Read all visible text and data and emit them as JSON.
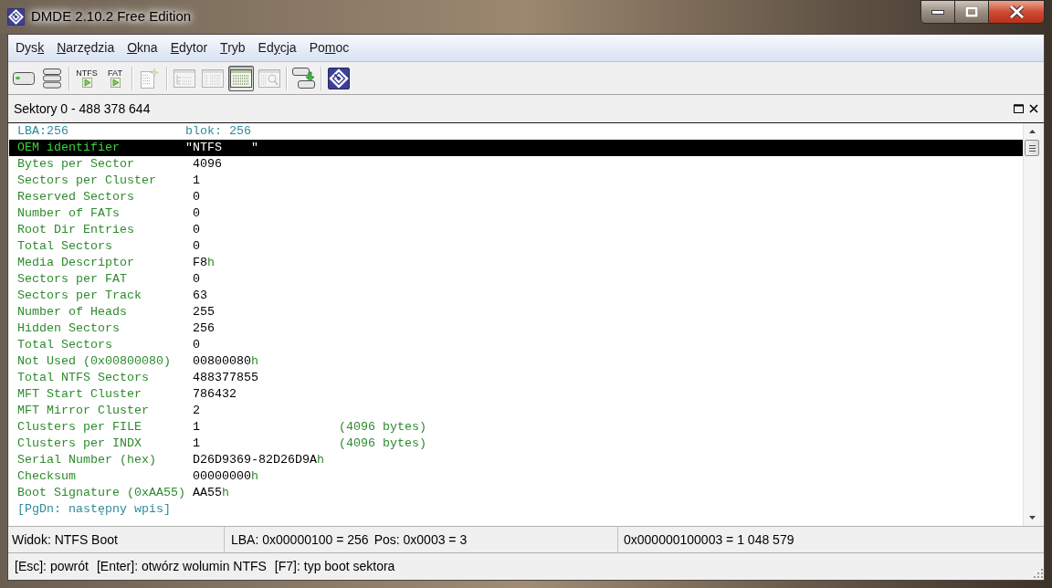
{
  "window": {
    "title": "DMDE 2.10.2 Free Edition"
  },
  "menu": [
    {
      "pre": "Dys",
      "accel": "k"
    },
    {
      "accel": "N",
      "post": "arzędzia"
    },
    {
      "accel": "O",
      "post": "kna"
    },
    {
      "accel": "E",
      "post": "dytor"
    },
    {
      "accel": "T",
      "post": "ryb"
    },
    {
      "pre": "Ed",
      "accel": "y",
      "post": "cja"
    },
    {
      "pre": "Po",
      "accel": "m",
      "post": "oc"
    }
  ],
  "toolbar": {
    "groups": [
      [
        {
          "kind": "drive",
          "disabled": false,
          "pressed": false
        },
        {
          "kind": "drive-stack",
          "disabled": false,
          "pressed": false
        }
      ],
      [
        {
          "kind": "labeled",
          "label": "NTFS",
          "disabled": false,
          "pressed": false
        },
        {
          "kind": "labeled",
          "label": "FAT",
          "disabled": false,
          "pressed": false
        }
      ],
      [
        {
          "kind": "new-doc",
          "disabled": true,
          "pressed": false
        }
      ],
      [
        {
          "kind": "tree-view",
          "disabled": true,
          "pressed": false
        },
        {
          "kind": "list-view",
          "disabled": true,
          "pressed": false
        },
        {
          "kind": "table-view",
          "disabled": false,
          "pressed": true
        },
        {
          "kind": "search-view",
          "disabled": true,
          "pressed": false
        }
      ],
      [
        {
          "kind": "copy",
          "disabled": false,
          "pressed": false
        }
      ],
      [
        {
          "kind": "logo",
          "disabled": false,
          "pressed": false
        }
      ]
    ]
  },
  "panel": {
    "title": "Sektory 0 - 488 378 644"
  },
  "header": {
    "lba": "LBA:256",
    "block": "blok: 256"
  },
  "rows": [
    {
      "label": "OEM identifier",
      "value": "\"NTFS    \"",
      "kind": "quoted",
      "selected": true
    },
    {
      "label": "Bytes per Sector",
      "value": "4096",
      "kind": "plain",
      "selected": false
    },
    {
      "label": "Sectors per Cluster",
      "value": "1",
      "kind": "plain",
      "selected": false
    },
    {
      "label": "Reserved Sectors",
      "value": "0",
      "kind": "plain",
      "selected": false
    },
    {
      "label": "Number of FATs",
      "value": "0",
      "kind": "plain",
      "selected": false
    },
    {
      "label": "Root Dir Entries",
      "value": "0",
      "kind": "plain",
      "selected": false
    },
    {
      "label": "Total Sectors",
      "value": "0",
      "kind": "plain",
      "selected": false
    },
    {
      "label": "Media Descriptor",
      "value": "F8",
      "unit": "h",
      "kind": "plain",
      "selected": false
    },
    {
      "label": "Sectors per FAT",
      "value": "0",
      "kind": "plain",
      "selected": false
    },
    {
      "label": "Sectors per Track",
      "value": "63",
      "kind": "plain",
      "selected": false
    },
    {
      "label": "Number of Heads",
      "value": "255",
      "kind": "plain",
      "selected": false
    },
    {
      "label": "Hidden Sectors",
      "value": "256",
      "kind": "plain",
      "selected": false
    },
    {
      "label": "Total Sectors",
      "value": "0",
      "kind": "plain",
      "selected": false
    },
    {
      "label": "Not Used (0x00800080)",
      "value": "00800080",
      "unit": "h",
      "kind": "plain",
      "selected": false
    },
    {
      "label": "Total NTFS Sectors",
      "value": "488377855",
      "kind": "plain",
      "selected": false
    },
    {
      "label": "MFT Start Cluster",
      "value": "786432",
      "kind": "plain",
      "selected": false
    },
    {
      "label": "MFT Mirror Cluster",
      "value": "2",
      "kind": "plain",
      "selected": false
    },
    {
      "label": "Clusters per FILE",
      "value": "1",
      "note": "(4096 bytes)",
      "kind": "plain",
      "selected": false
    },
    {
      "label": "Clusters per INDX",
      "value": "1",
      "note": "(4096 bytes)",
      "kind": "plain",
      "selected": false
    },
    {
      "label": "Serial Number (hex)",
      "value": "D26D9369-82D26D9A",
      "unit": "h",
      "kind": "plain",
      "selected": false
    },
    {
      "label": "Checksum",
      "value": "00000000",
      "unit": "h",
      "kind": "plain",
      "selected": false
    },
    {
      "label": "Boot Signature (0xAA55)",
      "value": "AA55",
      "unit": "h",
      "kind": "plain",
      "selected": false
    }
  ],
  "footer": "[PgDn: następny wpis]",
  "status_bar": {
    "view": "Widok: NTFS Boot",
    "lba": "LBA: 0x00000100 = 256",
    "pos": "Pos: 0x0003 = 3",
    "offset": "0x000000100003 = 1 048 579"
  },
  "hints": [
    "[Esc]: powrót",
    "[Enter]: otwórz wolumin NTFS",
    "[F7]: typ boot sektora"
  ]
}
